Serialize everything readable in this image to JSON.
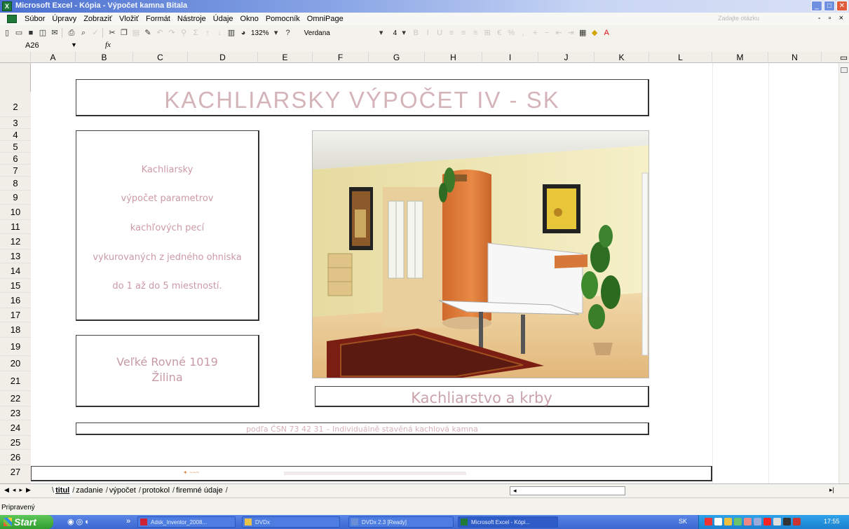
{
  "window": {
    "title": "Microsoft Excel - Kópia - Výpočet kamna Bitala"
  },
  "menu": {
    "items": [
      "Súbor",
      "Úpravy",
      "Zobraziť",
      "Vložiť",
      "Formát",
      "Nástroje",
      "Údaje",
      "Okno",
      "Pomocník",
      "OmniPage"
    ],
    "help_placeholder": "Zadajte otázku"
  },
  "toolbar": {
    "zoom": "132%",
    "font_name": "Verdana",
    "font_size": "4"
  },
  "formula_bar": {
    "name_box": "A26",
    "fx_label": "fx"
  },
  "columns": [
    "A",
    "B",
    "C",
    "D",
    "E",
    "F",
    "G",
    "H",
    "I",
    "J",
    "K",
    "L",
    "M",
    "N"
  ],
  "rows": [
    "2",
    "3",
    "4",
    "5",
    "6",
    "7",
    "8",
    "9",
    "10",
    "11",
    "12",
    "13",
    "14",
    "15",
    "16",
    "17",
    "18",
    "19",
    "20",
    "21",
    "22",
    "23",
    "24",
    "25",
    "26",
    "27"
  ],
  "sheet": {
    "heading": "KACHLIARSKY  VÝPOČET  IV - SK",
    "description": [
      "Kachliarsky",
      "výpočet parametrov",
      "kachľových pecí",
      "vykurovaných z jedného ohniska",
      "do 1 až do 5 miestností."
    ],
    "address": [
      "Veľké Rovné 1019",
      "Žilina"
    ],
    "company": "Kachliarstvo a krby",
    "norm": "podľa ČSN 73 42 31 – Individuálně stavěná kachlová kamna"
  },
  "sheet_tabs": {
    "tabs": [
      "titul",
      "zadanie",
      "výpočet",
      "protokol",
      "firemné údaje"
    ],
    "active": "titul"
  },
  "status": {
    "text": "Pripravený"
  },
  "taskbar": {
    "start_label": "Start",
    "tasks": [
      "Adsk_Inventor_2008...",
      "DVDx",
      "DVDx 2.3 [Ready]",
      "Microsoft Excel - Kópi..."
    ],
    "language": "SK",
    "clock": "17:55"
  },
  "colors": {
    "title_bar": "#4a6fd0",
    "pink_text": "#cc9aa5",
    "taskbar": "#3b67d0",
    "start": "#319c2f"
  }
}
